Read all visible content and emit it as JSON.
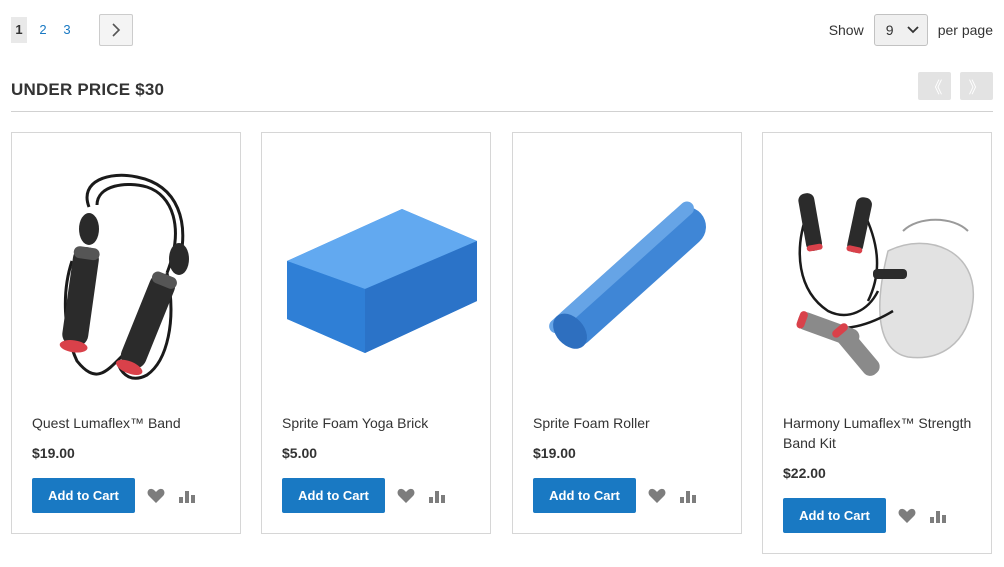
{
  "pager": {
    "pages": [
      "1",
      "2",
      "3"
    ],
    "current": "1",
    "next_icon": "chevron-right-icon"
  },
  "limiter": {
    "show_label": "Show",
    "selected": "9",
    "per_page_label": "per page"
  },
  "block": {
    "title": "UNDER PRICE $30",
    "prev_label": "《",
    "next_label": "》"
  },
  "products": [
    {
      "name": "Quest Lumaflex™ Band",
      "price": "$19.00",
      "cart_label": "Add to Cart",
      "image": "resistance-band"
    },
    {
      "name": "Sprite Foam Yoga Brick",
      "price": "$5.00",
      "cart_label": "Add to Cart",
      "image": "yoga-brick"
    },
    {
      "name": "Sprite Foam Roller",
      "price": "$19.00",
      "cart_label": "Add to Cart",
      "image": "foam-roller"
    },
    {
      "name": "Harmony Lumaflex™ Strength Band Kit",
      "price": "$22.00",
      "cart_label": "Add to Cart",
      "image": "band-kit"
    }
  ],
  "colors": {
    "accent": "#1979c3",
    "button_text": "#ffffff",
    "icon_gray": "#7d7d7d"
  }
}
